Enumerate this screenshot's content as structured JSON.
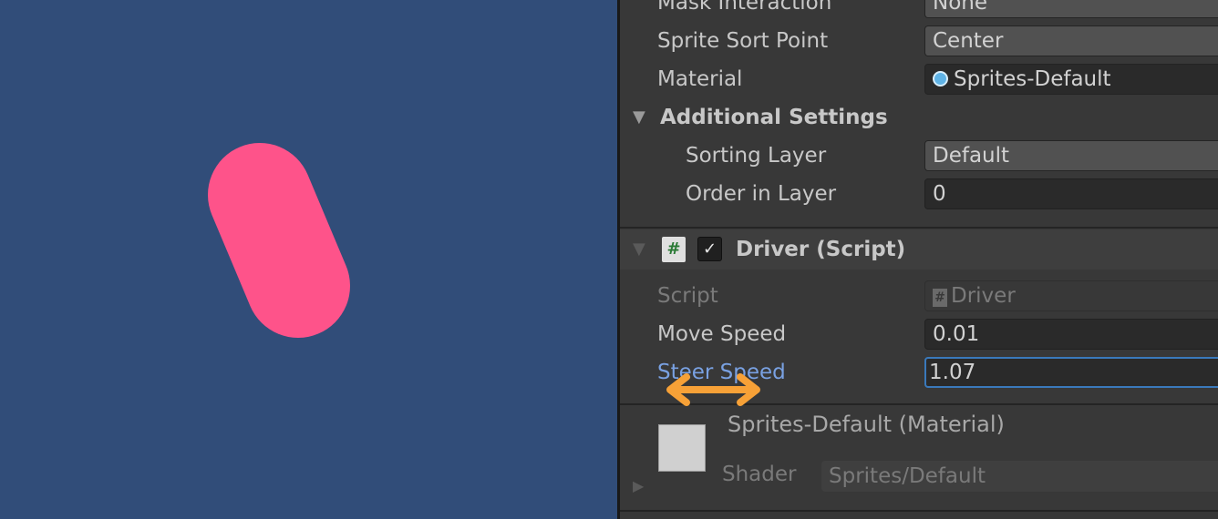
{
  "colors": {
    "scene_background": "#314d79",
    "capsule": "#fe538a",
    "inspector_background": "#383838",
    "active_label": "#79a1e2",
    "focus_border": "#3a79bb",
    "drag_arrow": "#f7a137"
  },
  "sprite_renderer": {
    "mask_interaction": {
      "label": "Mask Interaction",
      "value": "None"
    },
    "sprite_sort_point": {
      "label": "Sprite Sort Point",
      "value": "Center"
    },
    "material": {
      "label": "Material",
      "value": "Sprites-Default",
      "icon": "material-sphere-icon"
    },
    "additional_settings": {
      "title": "Additional Settings",
      "sorting_layer": {
        "label": "Sorting Layer",
        "value": "Default"
      },
      "order_in_layer": {
        "label": "Order in Layer",
        "value": "0"
      }
    }
  },
  "driver_component": {
    "title": "Driver (Script)",
    "enabled_check": "✓",
    "script_icon": "#",
    "script": {
      "label": "Script",
      "value": "Driver"
    },
    "move_speed": {
      "label": "Move Speed",
      "value": "0.01"
    },
    "steer_speed": {
      "label": "Steer Speed",
      "value": "1.07"
    }
  },
  "material_preview": {
    "title": "Sprites-Default (Material)",
    "shader_label": "Shader",
    "shader_value": "Sprites/Default"
  }
}
